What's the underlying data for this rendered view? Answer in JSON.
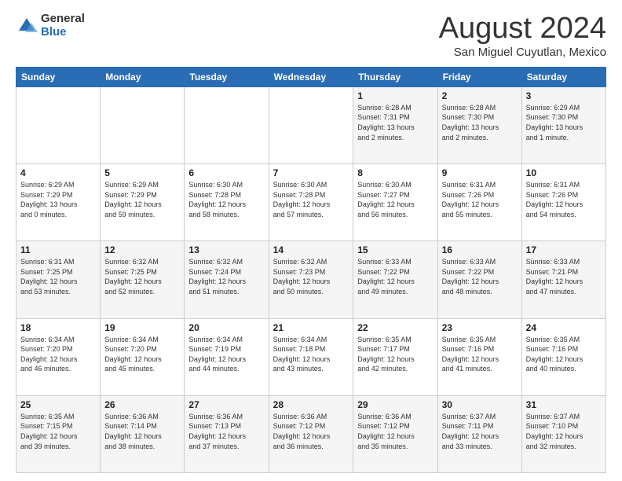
{
  "logo": {
    "general": "General",
    "blue": "Blue"
  },
  "header": {
    "title": "August 2024",
    "subtitle": "San Miguel Cuyutlan, Mexico"
  },
  "weekdays": [
    "Sunday",
    "Monday",
    "Tuesday",
    "Wednesday",
    "Thursday",
    "Friday",
    "Saturday"
  ],
  "weeks": [
    [
      {
        "day": "",
        "info": ""
      },
      {
        "day": "",
        "info": ""
      },
      {
        "day": "",
        "info": ""
      },
      {
        "day": "",
        "info": ""
      },
      {
        "day": "1",
        "info": "Sunrise: 6:28 AM\nSunset: 7:31 PM\nDaylight: 13 hours\nand 2 minutes."
      },
      {
        "day": "2",
        "info": "Sunrise: 6:28 AM\nSunset: 7:30 PM\nDaylight: 13 hours\nand 2 minutes."
      },
      {
        "day": "3",
        "info": "Sunrise: 6:29 AM\nSunset: 7:30 PM\nDaylight: 13 hours\nand 1 minute."
      }
    ],
    [
      {
        "day": "4",
        "info": "Sunrise: 6:29 AM\nSunset: 7:29 PM\nDaylight: 13 hours\nand 0 minutes."
      },
      {
        "day": "5",
        "info": "Sunrise: 6:29 AM\nSunset: 7:29 PM\nDaylight: 12 hours\nand 59 minutes."
      },
      {
        "day": "6",
        "info": "Sunrise: 6:30 AM\nSunset: 7:28 PM\nDaylight: 12 hours\nand 58 minutes."
      },
      {
        "day": "7",
        "info": "Sunrise: 6:30 AM\nSunset: 7:28 PM\nDaylight: 12 hours\nand 57 minutes."
      },
      {
        "day": "8",
        "info": "Sunrise: 6:30 AM\nSunset: 7:27 PM\nDaylight: 12 hours\nand 56 minutes."
      },
      {
        "day": "9",
        "info": "Sunrise: 6:31 AM\nSunset: 7:26 PM\nDaylight: 12 hours\nand 55 minutes."
      },
      {
        "day": "10",
        "info": "Sunrise: 6:31 AM\nSunset: 7:26 PM\nDaylight: 12 hours\nand 54 minutes."
      }
    ],
    [
      {
        "day": "11",
        "info": "Sunrise: 6:31 AM\nSunset: 7:25 PM\nDaylight: 12 hours\nand 53 minutes."
      },
      {
        "day": "12",
        "info": "Sunrise: 6:32 AM\nSunset: 7:25 PM\nDaylight: 12 hours\nand 52 minutes."
      },
      {
        "day": "13",
        "info": "Sunrise: 6:32 AM\nSunset: 7:24 PM\nDaylight: 12 hours\nand 51 minutes."
      },
      {
        "day": "14",
        "info": "Sunrise: 6:32 AM\nSunset: 7:23 PM\nDaylight: 12 hours\nand 50 minutes."
      },
      {
        "day": "15",
        "info": "Sunrise: 6:33 AM\nSunset: 7:22 PM\nDaylight: 12 hours\nand 49 minutes."
      },
      {
        "day": "16",
        "info": "Sunrise: 6:33 AM\nSunset: 7:22 PM\nDaylight: 12 hours\nand 48 minutes."
      },
      {
        "day": "17",
        "info": "Sunrise: 6:33 AM\nSunset: 7:21 PM\nDaylight: 12 hours\nand 47 minutes."
      }
    ],
    [
      {
        "day": "18",
        "info": "Sunrise: 6:34 AM\nSunset: 7:20 PM\nDaylight: 12 hours\nand 46 minutes."
      },
      {
        "day": "19",
        "info": "Sunrise: 6:34 AM\nSunset: 7:20 PM\nDaylight: 12 hours\nand 45 minutes."
      },
      {
        "day": "20",
        "info": "Sunrise: 6:34 AM\nSunset: 7:19 PM\nDaylight: 12 hours\nand 44 minutes."
      },
      {
        "day": "21",
        "info": "Sunrise: 6:34 AM\nSunset: 7:18 PM\nDaylight: 12 hours\nand 43 minutes."
      },
      {
        "day": "22",
        "info": "Sunrise: 6:35 AM\nSunset: 7:17 PM\nDaylight: 12 hours\nand 42 minutes."
      },
      {
        "day": "23",
        "info": "Sunrise: 6:35 AM\nSunset: 7:16 PM\nDaylight: 12 hours\nand 41 minutes."
      },
      {
        "day": "24",
        "info": "Sunrise: 6:35 AM\nSunset: 7:16 PM\nDaylight: 12 hours\nand 40 minutes."
      }
    ],
    [
      {
        "day": "25",
        "info": "Sunrise: 6:35 AM\nSunset: 7:15 PM\nDaylight: 12 hours\nand 39 minutes."
      },
      {
        "day": "26",
        "info": "Sunrise: 6:36 AM\nSunset: 7:14 PM\nDaylight: 12 hours\nand 38 minutes."
      },
      {
        "day": "27",
        "info": "Sunrise: 6:36 AM\nSunset: 7:13 PM\nDaylight: 12 hours\nand 37 minutes."
      },
      {
        "day": "28",
        "info": "Sunrise: 6:36 AM\nSunset: 7:12 PM\nDaylight: 12 hours\nand 36 minutes."
      },
      {
        "day": "29",
        "info": "Sunrise: 6:36 AM\nSunset: 7:12 PM\nDaylight: 12 hours\nand 35 minutes."
      },
      {
        "day": "30",
        "info": "Sunrise: 6:37 AM\nSunset: 7:11 PM\nDaylight: 12 hours\nand 33 minutes."
      },
      {
        "day": "31",
        "info": "Sunrise: 6:37 AM\nSunset: 7:10 PM\nDaylight: 12 hours\nand 32 minutes."
      }
    ]
  ]
}
